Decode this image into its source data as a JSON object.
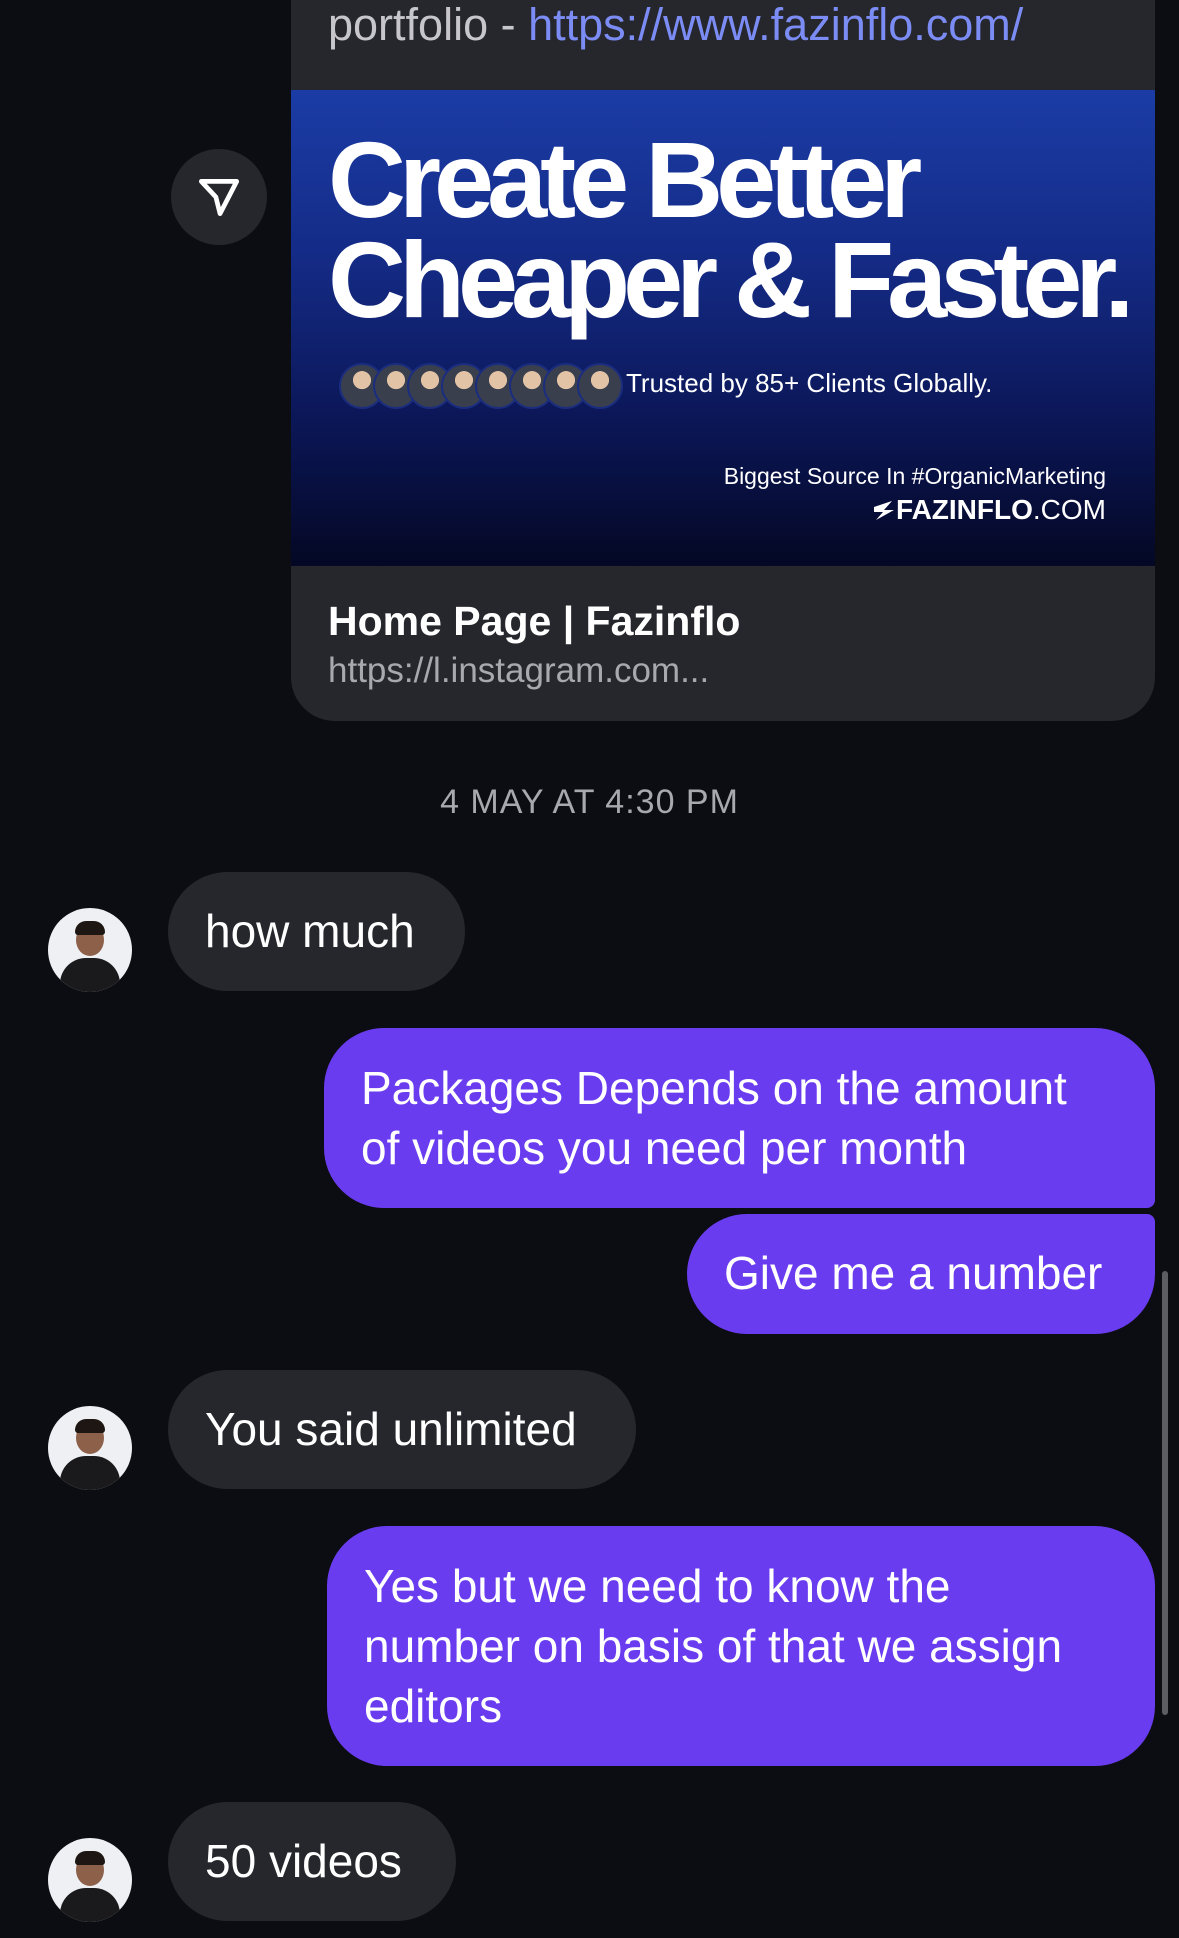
{
  "link_card": {
    "top_text_prefix": "portfolio - ",
    "top_text_link": "https://www.fazinflo.com/",
    "headline_line1": "Create Better",
    "headline_line2": "Cheaper & Faster.",
    "trusted_text": "Trusted by 85+ Clients Globally.",
    "source_text": "Biggest Source In #OrganicMarketing",
    "brand_bold": "FAZINFLO",
    "brand_suffix": ".COM",
    "title": "Home Page | Fazinflo",
    "url": "https://l.instagram.com..."
  },
  "timestamp": "4 MAY AT 4:30 PM",
  "messages": [
    {
      "from": "them",
      "text": "how much"
    },
    {
      "from": "me",
      "lines": [
        "Packages Depends on the amount",
        "of videos you need per month"
      ]
    },
    {
      "from": "me",
      "text": "Give me a number"
    },
    {
      "from": "them",
      "text": "You said unlimited"
    },
    {
      "from": "me",
      "lines": [
        "Yes but we need to know the",
        "number on basis of that we assign",
        "editors"
      ]
    },
    {
      "from": "them",
      "text": "50 videos"
    }
  ],
  "colors": {
    "background": "#0c0d12",
    "incoming_bubble": "#26272c",
    "outgoing_bubble": "#6a3cf0",
    "link": "#7c8cf5"
  },
  "icons": {
    "share": "paper-plane-icon",
    "brand": "bolt-icon"
  }
}
